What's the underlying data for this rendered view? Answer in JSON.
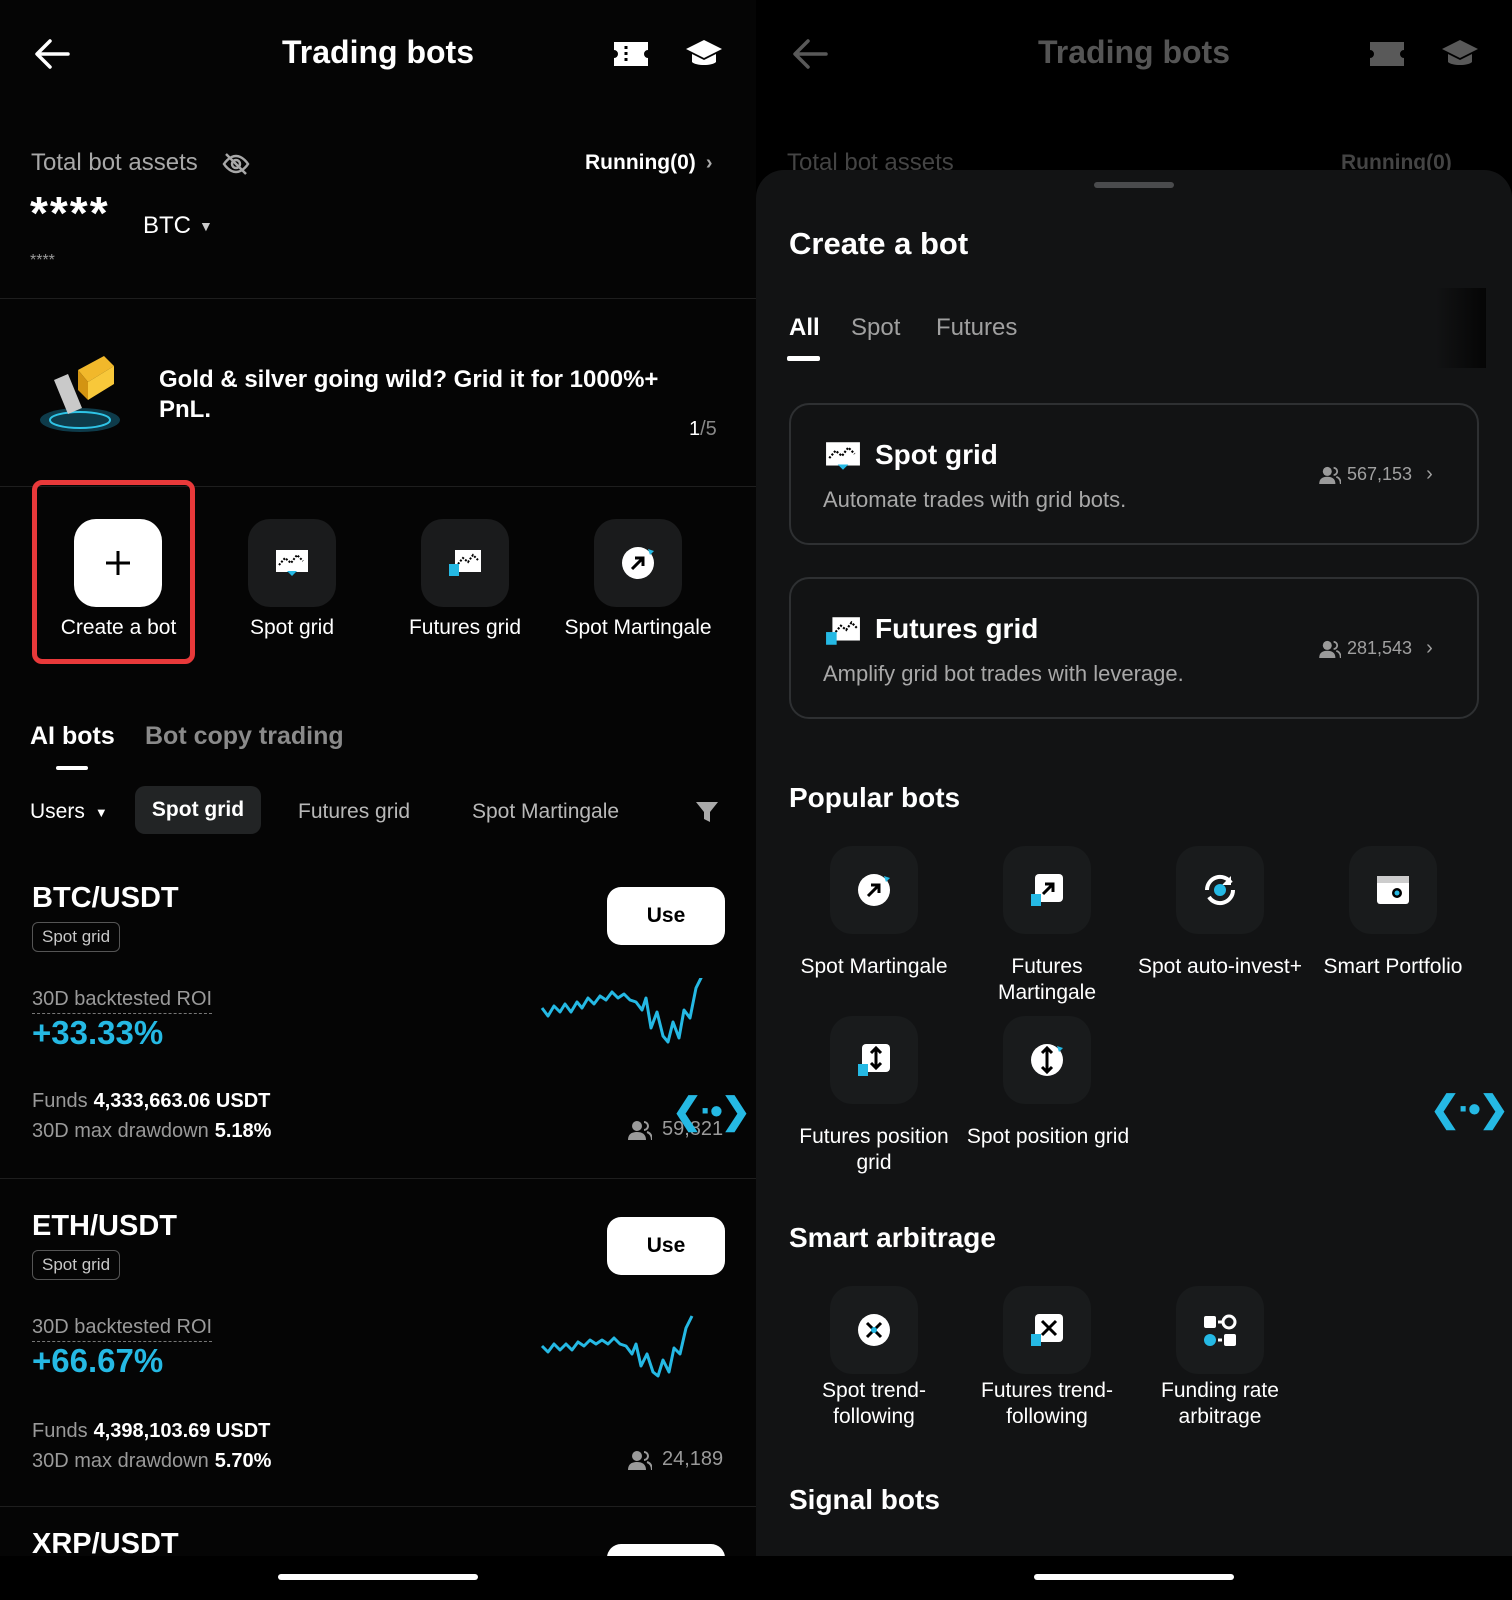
{
  "left": {
    "header": {
      "title": "Trading bots"
    },
    "assets": {
      "label": "Total bot assets",
      "running": "Running(0)",
      "value": "****",
      "currency": "BTC",
      "sub": "****"
    },
    "banner": {
      "text": "Gold & silver going wild? Grid it for 1000%+ PnL.",
      "page": "1",
      "total": "/5"
    },
    "quick": [
      {
        "label": "Create a bot",
        "icon": "plus-icon"
      },
      {
        "label": "Spot grid",
        "icon": "spot-grid-icon"
      },
      {
        "label": "Futures grid",
        "icon": "futures-grid-icon"
      },
      {
        "label": "Spot Martingale",
        "icon": "martingale-icon"
      }
    ],
    "tabs": [
      "AI bots",
      "Bot copy trading"
    ],
    "filters": {
      "sort": "Users",
      "chips": [
        "Spot grid",
        "Futures grid",
        "Spot Martingale"
      ]
    },
    "cards": [
      {
        "pair": "BTC/USDT",
        "tag": "Spot grid",
        "use": "Use",
        "roi_label": "30D backtested ROI",
        "roi": "+33.33%",
        "funds_label": "Funds",
        "funds": "4,333,663.06 USDT",
        "dd_label": "30D max drawdown",
        "dd": "5.18%",
        "users": "59,821"
      },
      {
        "pair": "ETH/USDT",
        "tag": "Spot grid",
        "use": "Use",
        "roi_label": "30D backtested ROI",
        "roi": "+66.67%",
        "funds_label": "Funds",
        "funds": "4,398,103.69 USDT",
        "dd_label": "30D max drawdown",
        "dd": "5.70%",
        "users": "24,189"
      },
      {
        "pair": "XRP/USDT"
      }
    ]
  },
  "right": {
    "header": {
      "title": "Trading bots"
    },
    "assets": {
      "label": "Total bot assets",
      "running": "Running(0)"
    },
    "sheet": {
      "title": "Create a bot",
      "tabs": [
        "All",
        "Spot",
        "Futures"
      ],
      "bots": [
        {
          "name": "Spot grid",
          "desc": "Automate trades with grid bots.",
          "users": "567,153"
        },
        {
          "name": "Futures grid",
          "desc": "Amplify grid bot trades with leverage.",
          "users": "281,543"
        }
      ],
      "popular_title": "Popular bots",
      "popular": [
        "Spot Martingale",
        "Futures Martingale",
        "Spot auto-invest+",
        "Smart Portfolio",
        "Futures position grid",
        "Spot position grid"
      ],
      "arb_title": "Smart arbitrage",
      "arb": [
        "Spot trend-following",
        "Futures trend-following",
        "Funding rate arbitrage"
      ],
      "signal_title": "Signal bots"
    }
  },
  "colors": {
    "accent": "#25b9e4",
    "highlight": "#e8393a",
    "background": "#000000",
    "sheet": "#121314"
  }
}
